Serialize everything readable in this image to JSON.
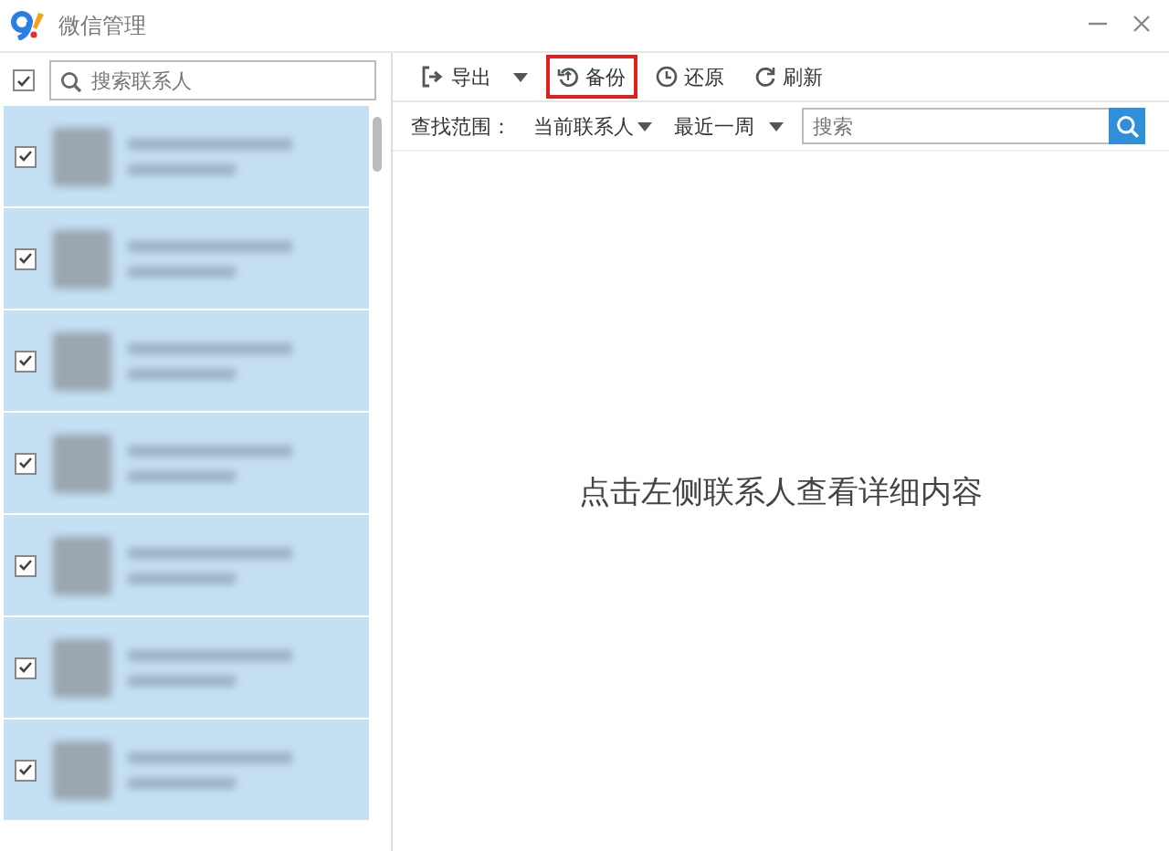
{
  "window": {
    "title": "微信管理"
  },
  "contacts": {
    "select_all_checked": true,
    "search": {
      "placeholder": "搜索联系人"
    },
    "rows": [
      {
        "checked": true
      },
      {
        "checked": true
      },
      {
        "checked": true
      },
      {
        "checked": true
      },
      {
        "checked": true
      },
      {
        "checked": true
      },
      {
        "checked": true
      }
    ]
  },
  "toolbar": [
    {
      "kind": "export",
      "label": "导出",
      "dropdown": true,
      "highlighted": false
    },
    {
      "kind": "backup",
      "label": "备份",
      "dropdown": false,
      "highlighted": true
    },
    {
      "kind": "restore",
      "label": "还原",
      "dropdown": false,
      "highlighted": false
    },
    {
      "kind": "refresh",
      "label": "刷新",
      "dropdown": false,
      "highlighted": false
    }
  ],
  "filter": {
    "label": "查找范围：",
    "scope": "当前联系人",
    "period": "最近一周",
    "search": {
      "placeholder": "搜索"
    }
  },
  "detail": {
    "message": "点击左侧联系人查看详细内容"
  }
}
